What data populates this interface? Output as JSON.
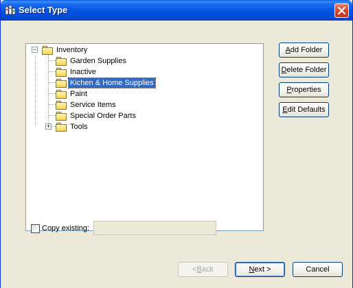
{
  "window": {
    "title": "Select Type"
  },
  "tree": {
    "root": {
      "label": "Inventory",
      "expander": "−"
    },
    "children": [
      {
        "label": "Garden Supplies",
        "selected": false
      },
      {
        "label": "Inactive",
        "selected": false
      },
      {
        "label": "Kichen & Home Supplies",
        "selected": true
      },
      {
        "label": "Paint",
        "selected": false
      },
      {
        "label": "Service Items",
        "selected": false
      },
      {
        "label": "Special Order Parts",
        "selected": false
      },
      {
        "label": "Tools",
        "selected": false,
        "expander": "+"
      }
    ]
  },
  "side_buttons": {
    "add_folder": {
      "mnemonic": "A",
      "rest": "dd Folder"
    },
    "delete_folder": {
      "mnemonic": "D",
      "rest": "elete Folder"
    },
    "properties": {
      "mnemonic": "P",
      "rest": "roperties"
    },
    "edit_defaults": {
      "mnemonic": "E",
      "rest": "dit Defaults"
    }
  },
  "copy_existing": {
    "label": "Copy existing:",
    "checked": false,
    "value": ""
  },
  "footer": {
    "back": {
      "mnemonic": "B",
      "pre": "< ",
      "rest": "ack",
      "enabled": false
    },
    "next": {
      "mnemonic": "N",
      "rest": "ext >"
    },
    "cancel": {
      "label": "Cancel"
    }
  },
  "colors": {
    "titlebar": "#0054e3",
    "selection": "#316ac5",
    "dialog_bg": "#ece9d8"
  }
}
